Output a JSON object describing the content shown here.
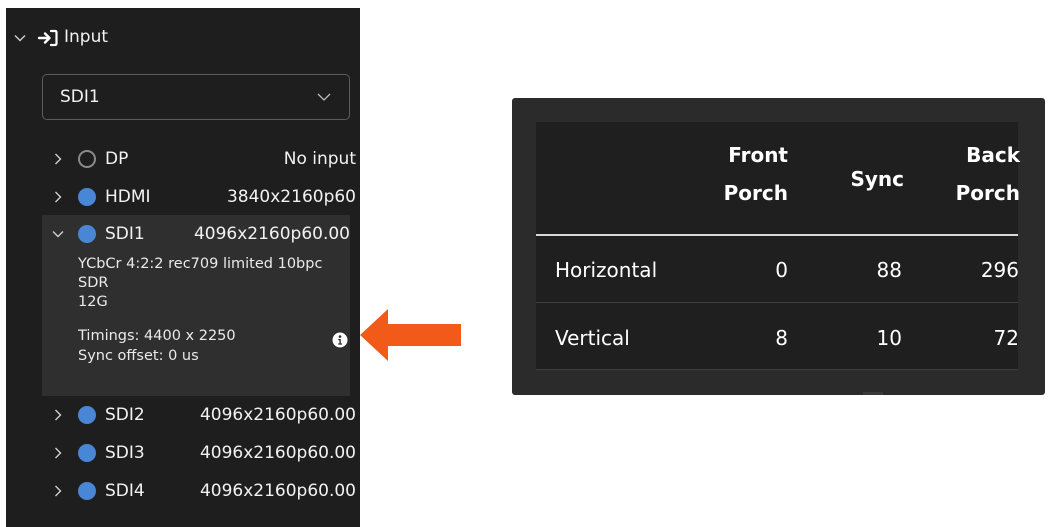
{
  "input_section": {
    "title": "Input",
    "icon": "sign-in-icon",
    "selected_source": "SDI1"
  },
  "sources": [
    {
      "name": "DP",
      "value": "No input",
      "active": false,
      "expanded": false
    },
    {
      "name": "HDMI",
      "value": "3840x2160p60",
      "active": true,
      "expanded": false
    },
    {
      "name": "SDI1",
      "value": "4096x2160p60.00",
      "active": true,
      "expanded": true,
      "details": {
        "format": "YCbCr 4:2:2 rec709 limited 10bpc",
        "range": "SDR",
        "link": "12G",
        "timings": "Timings: 4400 x 2250",
        "sync_offset": "Sync offset: 0 us"
      }
    },
    {
      "name": "SDI2",
      "value": "4096x2160p60.00",
      "active": true,
      "expanded": false
    },
    {
      "name": "SDI3",
      "value": "4096x2160p60.00",
      "active": true,
      "expanded": false
    },
    {
      "name": "SDI4",
      "value": "4096x2160p60.00",
      "active": true,
      "expanded": false
    }
  ],
  "timings_table": {
    "columns": {
      "front_porch": [
        "Front",
        "Porch"
      ],
      "sync": "Sync",
      "back_porch": [
        "Back",
        "Porch"
      ]
    },
    "rows": [
      {
        "label": "Horizontal",
        "front_porch": "0",
        "sync": "88",
        "back_porch": "296"
      },
      {
        "label": "Vertical",
        "front_porch": "8",
        "sync": "10",
        "back_porch": "72"
      }
    ]
  },
  "colors": {
    "panel_bg": "#1e1e1e",
    "active_dot": "#4a86d6",
    "arrow": "#f25a1a",
    "table_bg": "#1f1f1f"
  }
}
